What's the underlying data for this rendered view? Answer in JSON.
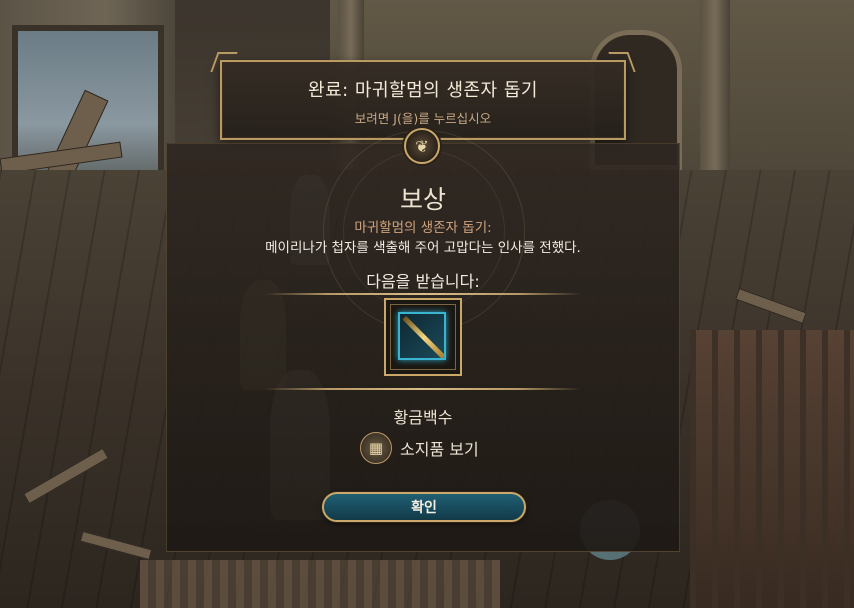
{
  "banner": {
    "title": "완료: 마귀할멈의 생존자 돕기",
    "hint": "보려면 J(을)를 누르십시오"
  },
  "reward": {
    "title": "보상",
    "quest_name": "마귀할멈의 생존자 돕기:",
    "description": "메이리나가 첩자를 색출해 주어 고맙다는 인사를 전했다.",
    "receive_label": "다음을 받습니다:",
    "item": {
      "name": "황금백수",
      "icon": "golden-sword-icon",
      "rarity_color": "#3bb4d2"
    },
    "inventory_button": {
      "label": "소지품 보기",
      "icon": "backpack-icon"
    },
    "confirm_button": {
      "label": "확인"
    }
  },
  "colors": {
    "accent_gold": "#c9a86a",
    "button_teal": "#17495a",
    "subtitle": "#cfa47d"
  }
}
